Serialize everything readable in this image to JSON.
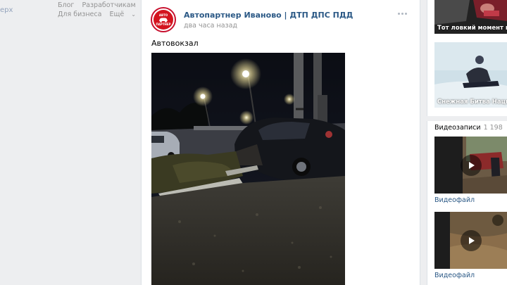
{
  "sidebar": {
    "up_link": "ерх",
    "footer": {
      "blog": "Блог",
      "developers": "Разработчикам",
      "business": "Для бизнеса",
      "more": "Ещё"
    }
  },
  "post": {
    "author": "Автопартнер Иваново | ДТП ДПС ПДД",
    "time": "два часа назад",
    "text": "Автовокзал",
    "avatar_text_top": "АВТО",
    "avatar_text_bottom": "ПАРТНЕР"
  },
  "right": {
    "thumb1_caption": "Тот ловкий момент ко",
    "thumb2_caption": "Снежная Битва Наци",
    "videos_title": "Видеозаписи",
    "videos_count": "1 198",
    "video1_label": "Видеофайл",
    "video2_label": "Видеофайл"
  },
  "colors": {
    "link": "#2a5885",
    "muted": "#939393",
    "background": "#edeef0",
    "brand_red": "#d3141f"
  },
  "icons": [
    "more-dots-icon",
    "chevron-down-icon",
    "play-icon",
    "car-icon"
  ]
}
